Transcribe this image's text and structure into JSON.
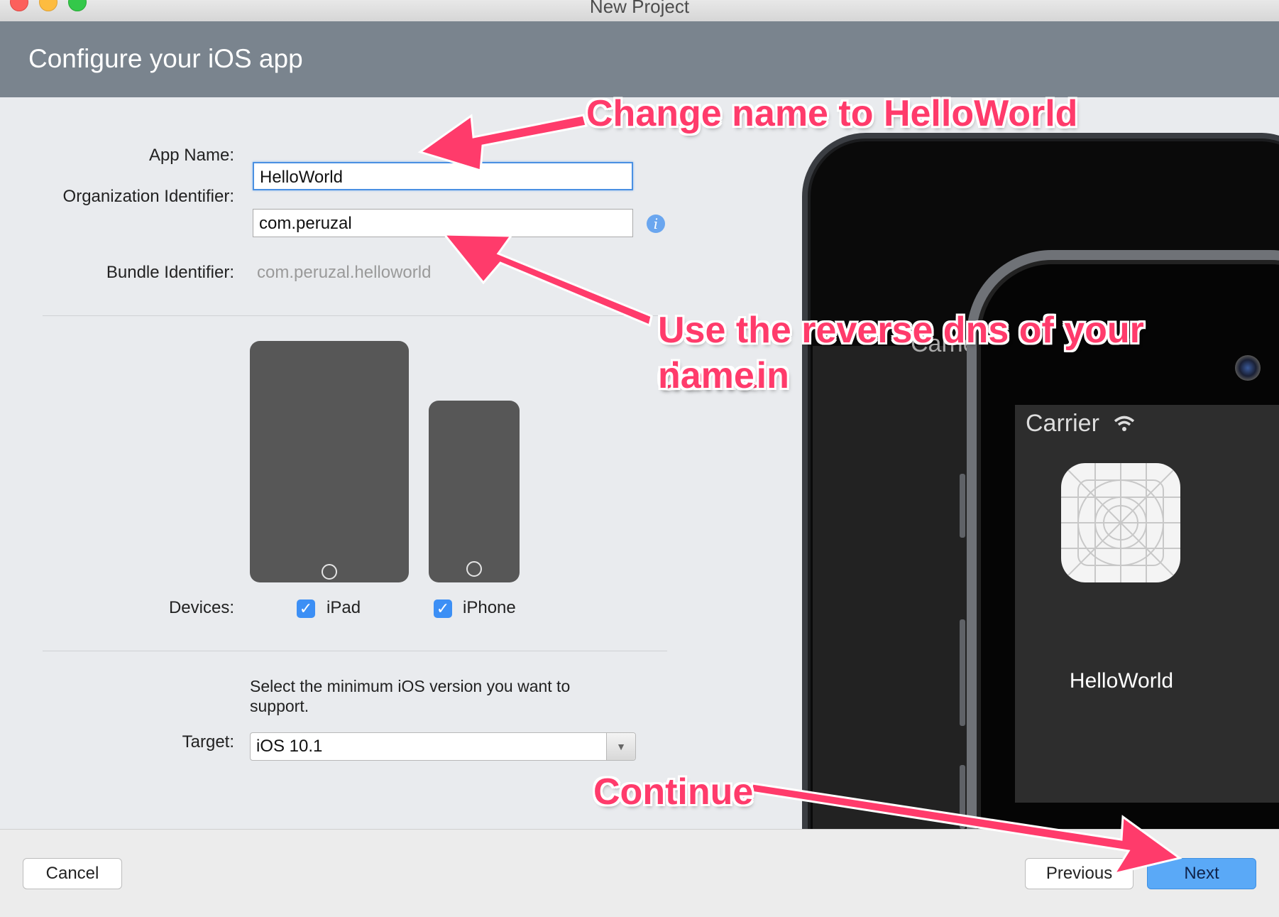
{
  "window": {
    "title": "New Project"
  },
  "header": {
    "title": "Configure your iOS app"
  },
  "form": {
    "app_name_label": "App Name:",
    "app_name_value": "HelloWorld",
    "org_id_label": "Organization Identifier:",
    "org_id_value": "com.peruzal",
    "bundle_id_label": "Bundle Identifier:",
    "bundle_id_value": "com.peruzal.helloworld",
    "devices_label": "Devices:",
    "devices": [
      {
        "label": "iPad",
        "checked": true
      },
      {
        "label": "iPhone",
        "checked": true
      }
    ],
    "target_hint": "Select the minimum iOS version you want to support.",
    "target_label": "Target:",
    "target_value": "iOS 10.1"
  },
  "preview": {
    "carrier_partial": "Carrie",
    "carrier": "Carrier",
    "app_name": "HelloWorld"
  },
  "footer": {
    "cancel_label": "Cancel",
    "previous_label": "Previous",
    "next_label": "Next"
  },
  "annotations": {
    "change_name": "Change name to HelloWorld",
    "reverse_dns_line1": "Use the reverse dns of your domain",
    "reverse_dns_line2": "name",
    "continue": "Continue",
    "color": "#ff3b6b"
  },
  "colors": {
    "header_bg": "#7a848e",
    "primary_button": "#5aa9f7",
    "checkbox": "#3c8ff5",
    "focus_ring": "#4a90e2"
  }
}
